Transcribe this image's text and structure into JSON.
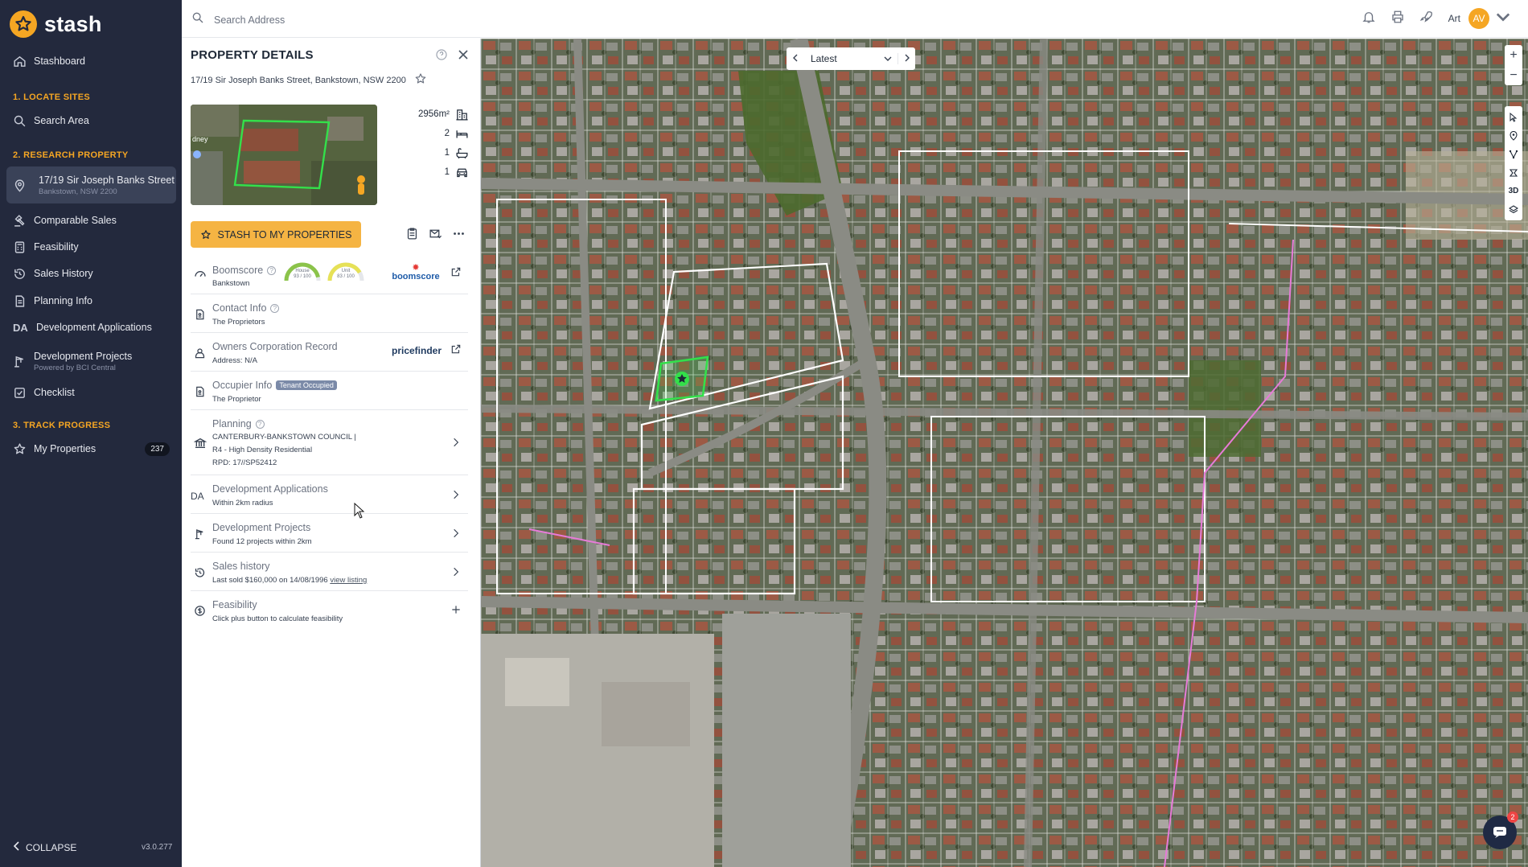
{
  "app": {
    "logo_text": "stash",
    "version": "v3.0.277",
    "collapse_label": "COLLAPSE"
  },
  "sidebar": {
    "stashboard": "Stashboard",
    "sections": {
      "locate": "1. LOCATE SITES",
      "research": "2. RESEARCH PROPERTY",
      "track": "3. TRACK PROGRESS"
    },
    "search_area": "Search Area",
    "active_property": {
      "title": "17/19 Sir Joseph Banks Street",
      "subtitle": "Bankstown, NSW 2200"
    },
    "comparable_sales": "Comparable Sales",
    "feasibility": "Feasibility",
    "sales_history": "Sales History",
    "planning_info": "Planning Info",
    "dev_apps_icon": "DA",
    "development_applications": "Development Applications",
    "development_projects": "Development Projects",
    "development_projects_sub": "Powered by BCI Central",
    "checklist": "Checklist",
    "my_properties": "My Properties",
    "my_properties_count": "237"
  },
  "topbar": {
    "search_placeholder": "Search Address",
    "user_name": "Art",
    "user_initials": "AV"
  },
  "panel": {
    "title": "PROPERTY DETAILS",
    "address": "17/19 Sir Joseph Banks Street, Bankstown, NSW 2200",
    "thumbnail_label": "dney",
    "stats": {
      "land_area": "2956m²",
      "beds": "2",
      "baths": "1",
      "cars": "1"
    },
    "stash_button": "STASH TO MY PROPERTIES",
    "boomscore": {
      "title": "Boomscore",
      "sub": "Bankstown",
      "house_label": "House",
      "house_score": "93 / 100",
      "house_value": 93,
      "unit_label": "Unit",
      "unit_score": "83 / 100",
      "unit_value": 83,
      "brand": "boomscore"
    },
    "contact": {
      "title": "Contact Info",
      "sub": "The Proprietors"
    },
    "owners": {
      "title": "Owners Corporation Record",
      "sub": "Address: N/A",
      "brand": "pricefinder"
    },
    "occupier": {
      "title": "Occupier Info",
      "tag": "Tenant Occupied",
      "sub": "The Proprietor"
    },
    "planning": {
      "title": "Planning",
      "line1": "CANTERBURY-BANKSTOWN COUNCIL |",
      "line2": "R4 - High Density Residential",
      "line3": "RPD: 17//SP52412"
    },
    "dev_apps": {
      "icon": "DA",
      "title": "Development Applications",
      "sub": "Within 2km radius"
    },
    "dev_projects": {
      "title": "Development Projects",
      "sub": "Found 12 projects within 2km"
    },
    "sales": {
      "title": "Sales history",
      "sub": "Last sold $160,000 on 14/08/1996",
      "link": "view listing"
    },
    "feasibility": {
      "title": "Feasibility",
      "sub": "Click plus button to calculate feasibility"
    }
  },
  "map": {
    "timeline_value": "Latest",
    "zoom_in": "+",
    "zoom_out": "−",
    "tool_3d": "3D",
    "chat_badge": "2"
  },
  "colors": {
    "sidebar_bg": "#23293d",
    "accent": "#f5a623",
    "stash_button": "#f5b443",
    "selected_parcel": "#33e04a",
    "parcel_outline": "#ffffff",
    "zoning_outline": "#e77bd8"
  }
}
